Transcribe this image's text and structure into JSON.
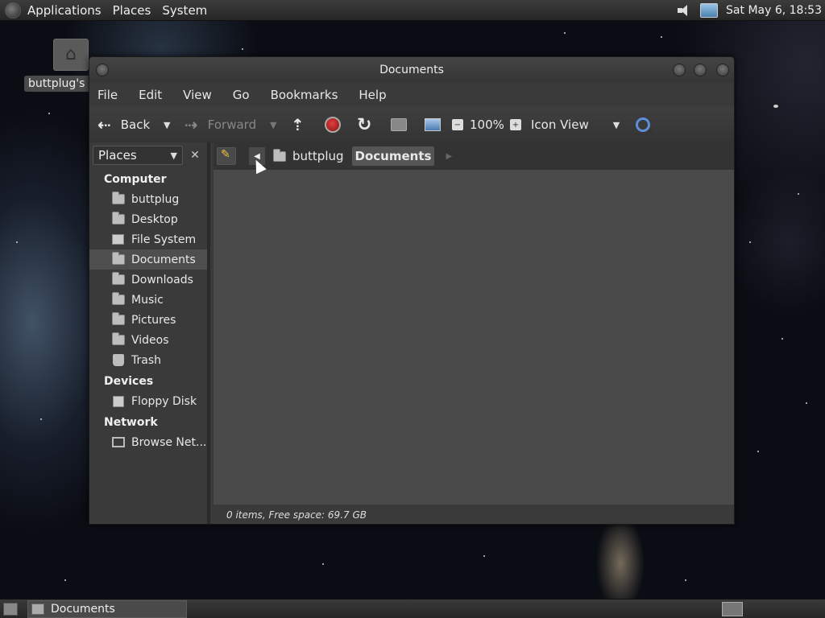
{
  "top_panel": {
    "menus": [
      "Applications",
      "Places",
      "System"
    ],
    "clock": "Sat May  6, 18:53"
  },
  "desktop": {
    "home_icon_label": "buttplug's Home"
  },
  "window": {
    "title": "Documents",
    "menubar": [
      "File",
      "Edit",
      "View",
      "Go",
      "Bookmarks",
      "Help"
    ],
    "toolbar": {
      "back_label": "Back",
      "forward_label": "Forward",
      "zoom_level": "100%",
      "view_mode": "Icon View"
    },
    "sidebar": {
      "selector_label": "Places",
      "sections": [
        {
          "label": "Computer",
          "items": [
            "buttplug",
            "Desktop",
            "File System",
            "Documents",
            "Downloads",
            "Music",
            "Pictures",
            "Videos",
            "Trash"
          ]
        },
        {
          "label": "Devices",
          "items": [
            "Floppy Disk"
          ]
        },
        {
          "label": "Network",
          "items": [
            "Browse Net..."
          ]
        }
      ],
      "active_item": "Documents"
    },
    "pathbar": {
      "crumbs": [
        "buttplug",
        "Documents"
      ]
    },
    "status": "0 items, Free space: 69.7 GB"
  },
  "taskbar": {
    "task_label": "Documents"
  },
  "colors": {
    "panel": "#2e2e2e",
    "window_bg": "#3a3a3a",
    "content_bg": "#4a4a4a",
    "selection": "#4e4e4e",
    "stop_red": "#c02020"
  }
}
